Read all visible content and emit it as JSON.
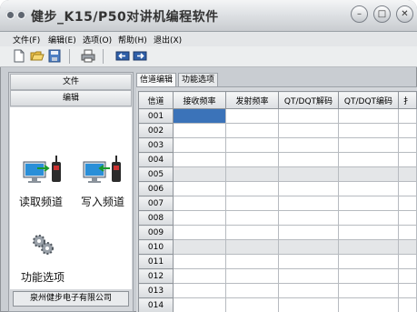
{
  "window": {
    "title": "健步_K15/P50对讲机编程软件"
  },
  "menu": [
    {
      "label": "文件(F)"
    },
    {
      "label": "编辑(E)"
    },
    {
      "label": "选项(O)"
    },
    {
      "label": "帮助(H)"
    },
    {
      "label": "退出(X)"
    }
  ],
  "toolbar": [
    "new-file-icon",
    "open-folder-icon",
    "save-icon",
    "print-icon",
    "read-from-radio-icon",
    "write-to-radio-icon"
  ],
  "sidebar": {
    "file_label": "文件",
    "edit_label": "编辑",
    "read_label": "读取频道",
    "write_label": "写入频道",
    "options_label": "功能选项",
    "company": "泉州健步电子有限公司"
  },
  "tabs": [
    {
      "label": "信道编辑",
      "active": true
    },
    {
      "label": "功能选项",
      "active": false
    }
  ],
  "grid": {
    "columns": [
      "信道",
      "接收频率",
      "发射频率",
      "QT/DQT解码",
      "QT/DQT编码",
      "扌"
    ],
    "rows": [
      "001",
      "002",
      "003",
      "004",
      "005",
      "006",
      "007",
      "008",
      "009",
      "010",
      "011",
      "012",
      "013",
      "014"
    ],
    "shaded_rows": [
      "005",
      "010"
    ],
    "selected_row": "001"
  },
  "colors": {
    "selection": "#3b73b9",
    "shaded_row": "#e4e6e8"
  }
}
